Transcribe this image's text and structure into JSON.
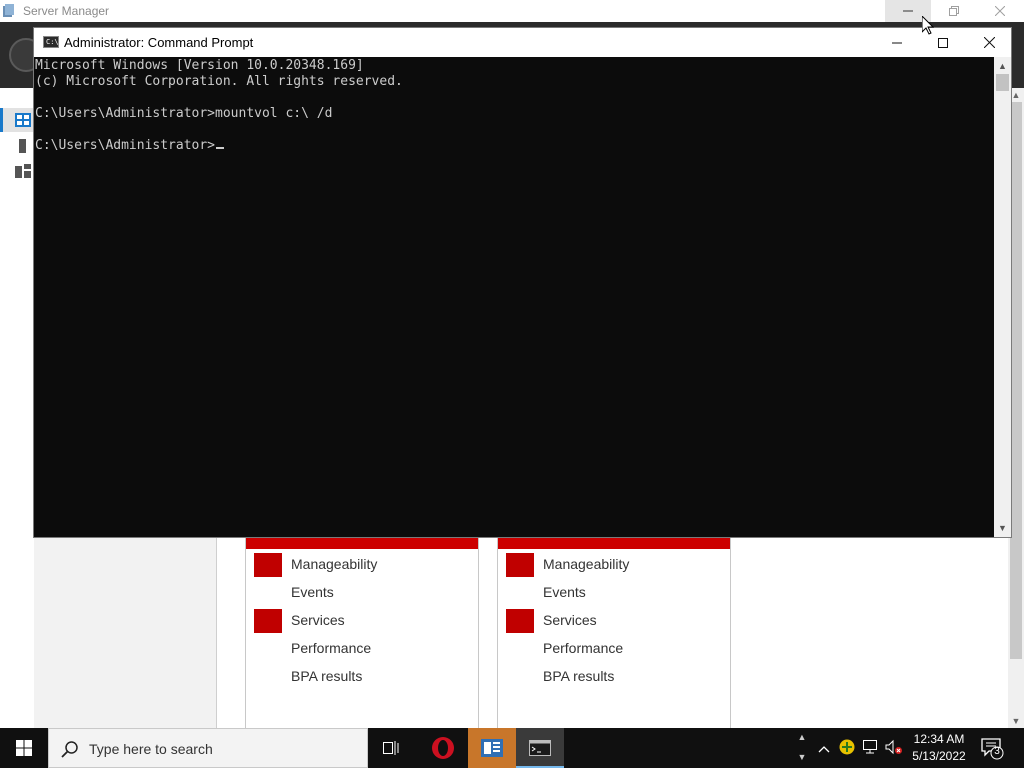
{
  "server_manager": {
    "title": "Server Manager",
    "tile_rows": [
      {
        "label": "Manageability",
        "flagged": true
      },
      {
        "label": "Events",
        "flagged": false
      },
      {
        "label": "Services",
        "flagged": true
      },
      {
        "label": "Performance",
        "flagged": false
      },
      {
        "label": "BPA results",
        "flagged": false
      }
    ],
    "status_color": "#cc0000"
  },
  "cmd": {
    "title": "Administrator: Command Prompt",
    "lines": [
      "Microsoft Windows [Version 10.0.20348.169]",
      "(c) Microsoft Corporation. All rights reserved.",
      "",
      "C:\\Users\\Administrator>mountvol c:\\ /d",
      "",
      "C:\\Users\\Administrator>"
    ]
  },
  "taskbar": {
    "search_placeholder": "Type here to search",
    "clock_time": "12:34 AM",
    "clock_date": "5/13/2022",
    "notification_count": "3",
    "icons": [
      "windows-start-icon",
      "search-icon",
      "task-view-icon",
      "opera-icon",
      "server-manager-icon",
      "command-prompt-icon",
      "chevron-up-icon",
      "security-shield-icon",
      "network-icon",
      "volume-muted-icon",
      "notification-icon"
    ]
  }
}
